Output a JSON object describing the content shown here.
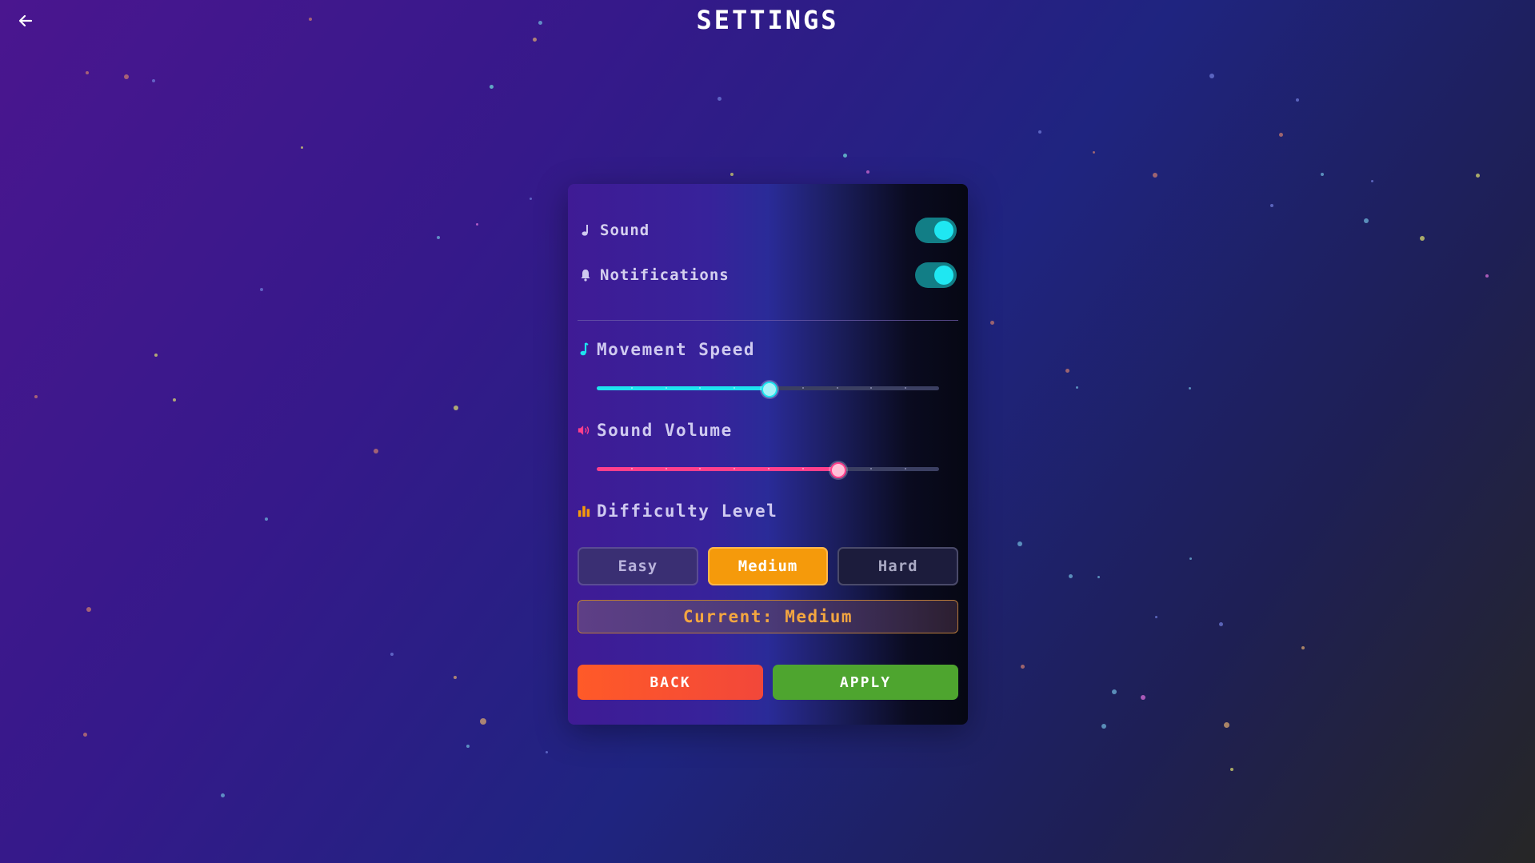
{
  "header": {
    "title": "SETTINGS",
    "back_icon": "arrow-left-icon"
  },
  "toggles": [
    {
      "label": "Sound",
      "icon": "music-note-icon",
      "on": true
    },
    {
      "label": "Notifications",
      "icon": "bell-icon",
      "on": true
    }
  ],
  "sliders": {
    "movement_speed": {
      "label": "Movement Speed",
      "icon": "music-note-icon",
      "value": 0.5,
      "color": "#1ee3ef"
    },
    "sound_volume": {
      "label": "Sound Volume",
      "icon": "speaker-icon",
      "value": 0.7,
      "color": "#ff3f8c"
    }
  },
  "difficulty": {
    "label": "Difficulty Level",
    "icon": "bar-chart-icon",
    "options": [
      "Easy",
      "Medium",
      "Hard"
    ],
    "selected": "Medium",
    "current_text": "Current: Medium"
  },
  "actions": {
    "back_label": "BACK",
    "apply_label": "APPLY"
  },
  "colors": {
    "accent_cyan": "#1ee3ef",
    "accent_pink": "#ff3f8c",
    "accent_orange": "#f59a0b",
    "back_button": "#f2473a",
    "apply_button": "#4ea52f"
  }
}
